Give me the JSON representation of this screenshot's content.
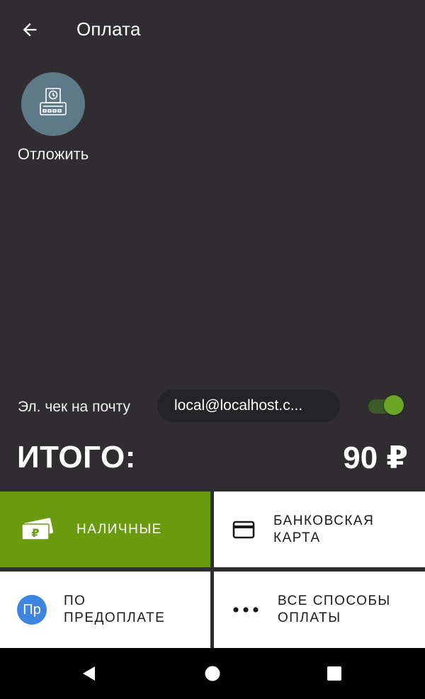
{
  "appbar": {
    "title": "Оплата",
    "back_icon": "arrow-left-icon"
  },
  "defer_action": {
    "label": "Отложить",
    "icon": "receipt-printer-clock-icon",
    "circle_color": "#5e7a88"
  },
  "email_receipt": {
    "label": "Эл. чек на почту",
    "value": "local@localhost.c...",
    "enabled": true
  },
  "total": {
    "label": "ИТОГО:",
    "value": "90 ₽"
  },
  "payment_methods": [
    {
      "id": "cash",
      "lines": [
        "НАЛИЧНЫЕ"
      ],
      "icon": "cash-ruble-icon",
      "selected": true
    },
    {
      "id": "card",
      "lines": [
        "БАНКОВСКАЯ",
        "КАРТА"
      ],
      "icon": "credit-card-icon",
      "selected": false
    },
    {
      "id": "prepaid",
      "lines": [
        "ПО",
        "ПРЕДОПЛАТЕ"
      ],
      "icon": "prepaid-badge-icon",
      "icon_text": "Пр",
      "selected": false
    },
    {
      "id": "all",
      "lines": [
        "ВСЕ СПОСОБЫ",
        "ОПЛАТЫ"
      ],
      "icon": "more-dots-icon",
      "selected": false
    }
  ],
  "navbar": {
    "back_icon": "nav-back-triangle-icon",
    "home_icon": "nav-home-circle-icon",
    "recents_icon": "nav-recents-square-icon"
  },
  "colors": {
    "background": "#2f2d30",
    "accent_green": "#6a9b0f",
    "toggle_on": "#6aa526",
    "prepaid_blue": "#3d85e0"
  }
}
